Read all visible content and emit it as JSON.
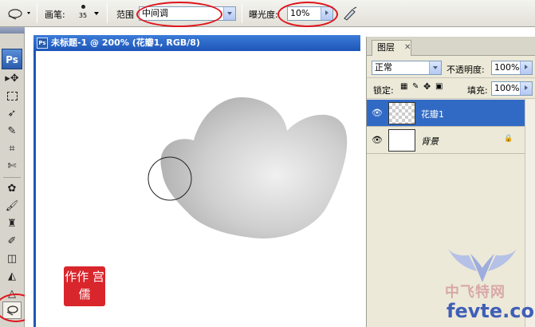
{
  "options_bar": {
    "brush_label": "画笔:",
    "brush_size": "35",
    "range_label": "范围",
    "range_value": "中间调",
    "exposure_label": "曝光度:",
    "exposure_value": "10%"
  },
  "toolbox": {
    "logo": "Ps",
    "tools": [
      "move-tool",
      "marquee-tool",
      "lasso-tool",
      "magic-wand-tool",
      "crop-tool",
      "slice-tool",
      "healing-brush-tool",
      "brush-tool",
      "clone-stamp-tool",
      "history-brush-tool",
      "eraser-tool",
      "paint-bucket-tool",
      "blur-tool",
      "dodge-tool"
    ],
    "selected_tool": "dodge-tool"
  },
  "document": {
    "title": "未标题-1 @ 200% (花瓣1, RGB/8)"
  },
  "layers_panel": {
    "tab_label": "图层",
    "blend_mode": "正常",
    "opacity_label": "不透明度:",
    "opacity_value": "100%",
    "lock_label": "锁定:",
    "fill_label": "填充:",
    "fill_value": "100%",
    "layers": [
      {
        "name": "花瓣1",
        "selected": true,
        "locked": false
      },
      {
        "name": "背景",
        "selected": false,
        "locked": true
      }
    ]
  },
  "stamp": {
    "text": "作作 宫儒"
  },
  "watermark": {
    "text": "中飞特网",
    "url": "fevte.com"
  },
  "colors": {
    "highlight_ring": "#e0141c",
    "selection": "#316ac5",
    "title_bar": "#1e56b8"
  }
}
